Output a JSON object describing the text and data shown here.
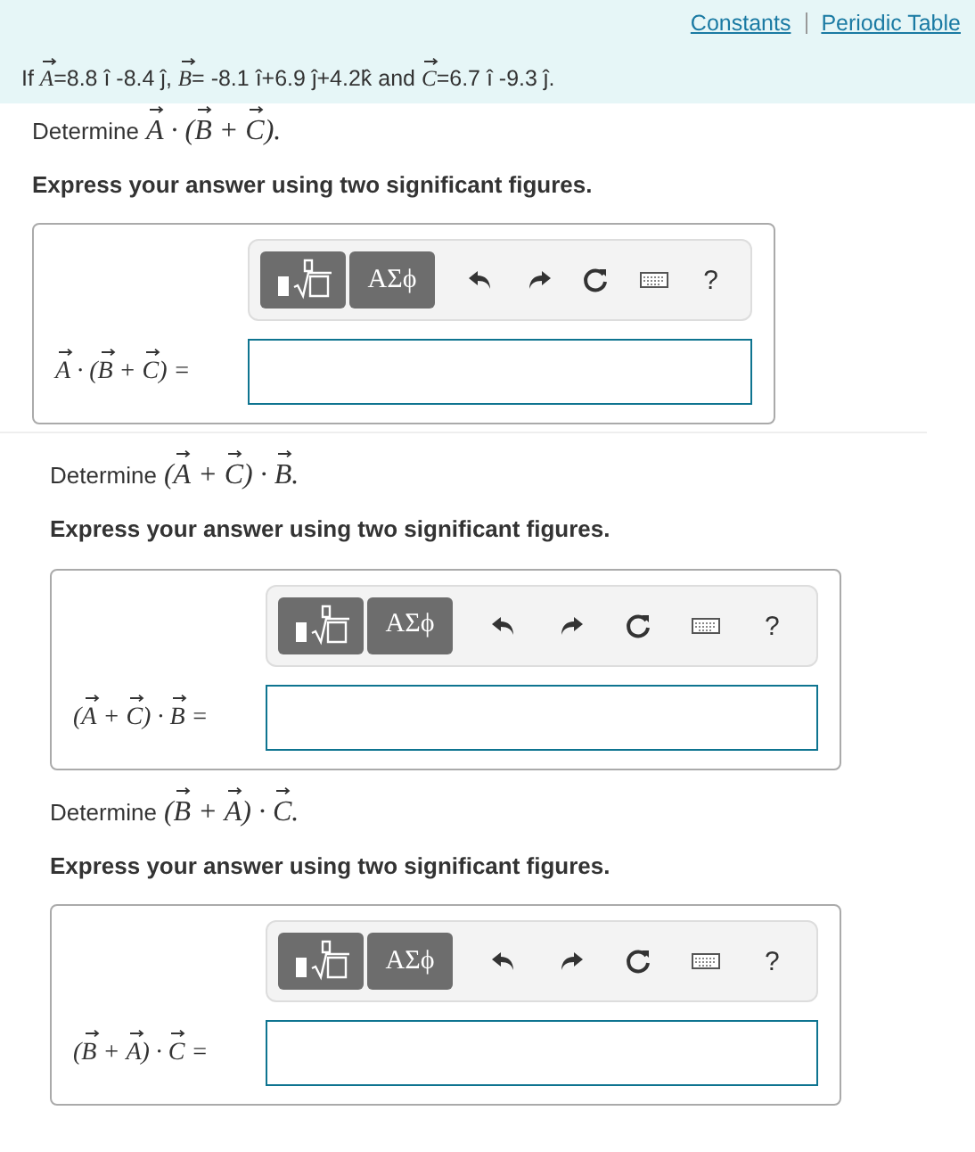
{
  "links": [
    "Constants",
    "Periodic Table"
  ],
  "statement": [
    {
      "text": "If "
    },
    {
      "text": "A",
      "vector": true
    },
    {
      "text": "=8.8 î -8.4 ĵ, "
    },
    {
      "text": "B",
      "vector": true
    },
    {
      "text": "= -8.1 î+6.9 ĵ+4.2k̂ and "
    },
    {
      "text": "C",
      "vector": true
    },
    {
      "text": "=6.7 î -9.3 ĵ."
    }
  ],
  "parts": [
    {
      "prompt": "Determine",
      "expression": [
        {
          "text": "A",
          "vector": true
        },
        {
          "text": " · ("
        },
        {
          "text": "B",
          "vector": true
        },
        {
          "text": " + "
        },
        {
          "text": "C",
          "vector": true
        },
        {
          "text": ")."
        }
      ],
      "instruction": "Express your answer using two significant figures.",
      "symbols_button": "ΑΣϕ",
      "help_button": "?",
      "answer_label": [
        {
          "text": "A",
          "vector": true
        },
        {
          "text": " · ("
        },
        {
          "text": "B",
          "vector": true
        },
        {
          "text": " + "
        },
        {
          "text": "C",
          "vector": true
        },
        {
          "text": ") ="
        }
      ]
    },
    {
      "prompt": "Determine",
      "expression": [
        {
          "text": "("
        },
        {
          "text": "A",
          "vector": true
        },
        {
          "text": " + "
        },
        {
          "text": "C",
          "vector": true
        },
        {
          "text": ") · "
        },
        {
          "text": "B",
          "vector": true
        },
        {
          "text": "."
        }
      ],
      "instruction": "Express your answer using two significant figures.",
      "symbols_button": "ΑΣϕ",
      "help_button": "?",
      "answer_label": [
        {
          "text": "("
        },
        {
          "text": "A",
          "vector": true
        },
        {
          "text": " + "
        },
        {
          "text": "C",
          "vector": true
        },
        {
          "text": ") · "
        },
        {
          "text": "B",
          "vector": true
        },
        {
          "text": " ="
        }
      ]
    },
    {
      "prompt": "Determine",
      "expression": [
        {
          "text": "("
        },
        {
          "text": "B",
          "vector": true
        },
        {
          "text": " + "
        },
        {
          "text": "A",
          "vector": true
        },
        {
          "text": ") · "
        },
        {
          "text": "C",
          "vector": true
        },
        {
          "text": "."
        }
      ],
      "instruction": "Express your answer using two significant figures.",
      "symbols_button": "ΑΣϕ",
      "help_button": "?",
      "answer_label": [
        {
          "text": "("
        },
        {
          "text": "B",
          "vector": true
        },
        {
          "text": " + "
        },
        {
          "text": "A",
          "vector": true
        },
        {
          "text": ") · "
        },
        {
          "text": "C",
          "vector": true
        },
        {
          "text": " ="
        }
      ]
    }
  ]
}
